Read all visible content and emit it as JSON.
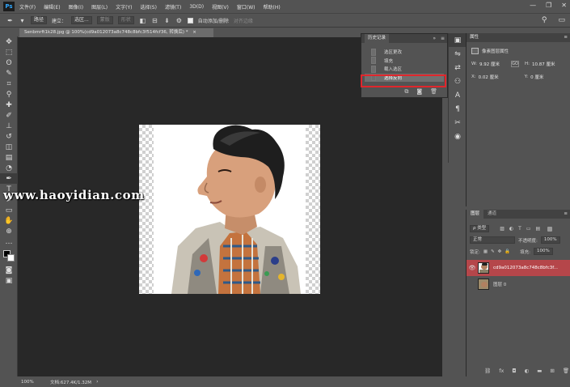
{
  "app": {
    "logo": "Ps"
  },
  "menu": {
    "items": [
      "文件(F)",
      "编辑(E)",
      "图像(I)",
      "图层(L)",
      "文字(Y)",
      "选择(S)",
      "滤镜(T)",
      "3D(D)",
      "视图(V)",
      "窗口(W)",
      "帮助(H)"
    ]
  },
  "window_controls": {
    "minimize": "—",
    "restore": "❐",
    "close": "✕"
  },
  "options_bar": {
    "tool_icon": "pen-tool-icon",
    "mode_select": "路径",
    "make_label": "建立：",
    "selection_button": "选区...",
    "mask_button": "蒙版",
    "shape_button": "形状",
    "auto_add_delete_label": "自动添加/删除",
    "auto_add_delete_checked": true,
    "align_edges_label": "对齐边缘",
    "right_icons": [
      "search-icon",
      "workspace-icon"
    ]
  },
  "document": {
    "tab_title": "Senbmrft1k28.jpg @ 100%(cd9a012073a8c748c8bfc3f514fcf36, 转换后) *",
    "tab_close": "×"
  },
  "watermark": "www.haoyidian.com",
  "statusbar": {
    "zoom": "100%",
    "doc_size": "文档:627.4K/1.32M",
    "arrow": "›"
  },
  "tools": [
    {
      "name": "move-tool-icon",
      "glyph": "✥"
    },
    {
      "name": "marquee-tool-icon",
      "glyph": "⬚"
    },
    {
      "name": "lasso-tool-icon",
      "glyph": "ʘ"
    },
    {
      "name": "quick-select-tool-icon",
      "glyph": "✎"
    },
    {
      "name": "crop-tool-icon",
      "glyph": "⌗"
    },
    {
      "name": "eyedropper-tool-icon",
      "glyph": "⚲"
    },
    {
      "name": "healing-brush-tool-icon",
      "glyph": "✚"
    },
    {
      "name": "brush-tool-icon",
      "glyph": "✐"
    },
    {
      "name": "clone-stamp-tool-icon",
      "glyph": "⊥"
    },
    {
      "name": "history-brush-tool-icon",
      "glyph": "↺"
    },
    {
      "name": "eraser-tool-icon",
      "glyph": "◫"
    },
    {
      "name": "gradient-tool-icon",
      "glyph": "▤"
    },
    {
      "name": "dodge-tool-icon",
      "glyph": "◔"
    },
    {
      "name": "pen-tool-icon",
      "glyph": "✒",
      "active": true
    },
    {
      "name": "type-tool-icon",
      "glyph": "T"
    },
    {
      "name": "path-select-tool-icon",
      "glyph": "➤"
    },
    {
      "name": "rectangle-tool-icon",
      "glyph": "▭"
    },
    {
      "name": "hand-tool-icon",
      "glyph": "✋"
    },
    {
      "name": "zoom-tool-icon",
      "glyph": "⊕"
    },
    {
      "name": "more-tools-icon",
      "glyph": "…"
    }
  ],
  "history_panel": {
    "title": "历史记录",
    "collapse": "»",
    "menu": "≡",
    "items": [
      "选区更改",
      "填充",
      "载入选区",
      "选择反向"
    ],
    "selected_index": 3,
    "footer_icons": [
      "new-document-from-state-icon",
      "snapshot-icon",
      "delete-state-icon"
    ]
  },
  "dock": {
    "icons": [
      "history-dock-icon",
      "adjust-dock-icon",
      "brush-dock-icon",
      "people-dock-icon",
      "character-dock-icon",
      "paragraph-dock-icon",
      "tools-dock-icon",
      "3d-dock-icon"
    ]
  },
  "properties_panel": {
    "title": "属性",
    "menu": "≡",
    "subtitle": "像素图层属性",
    "w_label": "W:",
    "w_value": "9.92 厘米",
    "h_label": "H:",
    "h_value": "10.87 厘米",
    "x_label": "X:",
    "x_value": "0.02 厘米",
    "y_label": "Y:",
    "y_value": "0 厘米",
    "link_label": "GO"
  },
  "layers_panel": {
    "tabs": [
      "图层",
      "通道"
    ],
    "active_tab": 0,
    "menu": "≡",
    "filter_kind": "ρ 类型",
    "blend_mode": "正常",
    "opacity_label": "不透明度:",
    "opacity_value": "100%",
    "lock_label": "锁定:",
    "fill_label": "填充:",
    "fill_value": "100%",
    "layers": [
      {
        "name": "cd9a012073a8c748c8bfc3f...",
        "visible": true,
        "selected": true
      },
      {
        "name": "图层 0",
        "visible": false,
        "selected": false
      }
    ],
    "footer_icons": [
      "link-layers-icon",
      "fx-icon",
      "add-mask-icon",
      "adjustment-layer-icon",
      "group-icon",
      "new-layer-icon",
      "trash-icon"
    ]
  },
  "colors": {
    "ui_bg": "#535353",
    "canvas_bg": "#282828",
    "highlight_red": "#e0262c",
    "selected_layer": "#b5464a"
  }
}
